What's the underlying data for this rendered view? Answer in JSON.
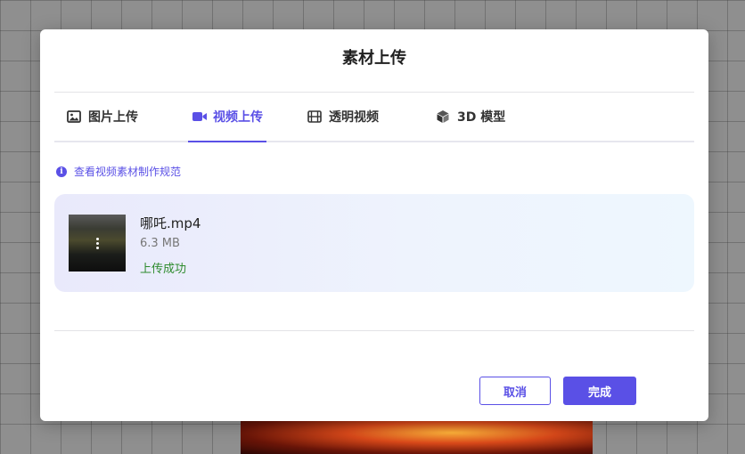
{
  "modal": {
    "title": "素材上传"
  },
  "tabs": [
    {
      "label": "图片上传",
      "icon": "image-icon",
      "active": false
    },
    {
      "label": "视频上传",
      "icon": "video-camera-icon",
      "active": true
    },
    {
      "label": "透明视频",
      "icon": "film-icon",
      "active": false
    },
    {
      "label": "3D 模型",
      "icon": "cube-icon",
      "active": false
    }
  ],
  "guide": {
    "text": "查看视频素材制作规范",
    "icon": "info-icon"
  },
  "file": {
    "name": "哪吒.mp4",
    "size": "6.3 MB",
    "status": "上传成功",
    "menu_icon": "more-vertical-icon"
  },
  "footer": {
    "cancel_label": "取消",
    "done_label": "完成"
  },
  "colors": {
    "accent": "#5a50e6",
    "success": "#2e8b2e"
  }
}
